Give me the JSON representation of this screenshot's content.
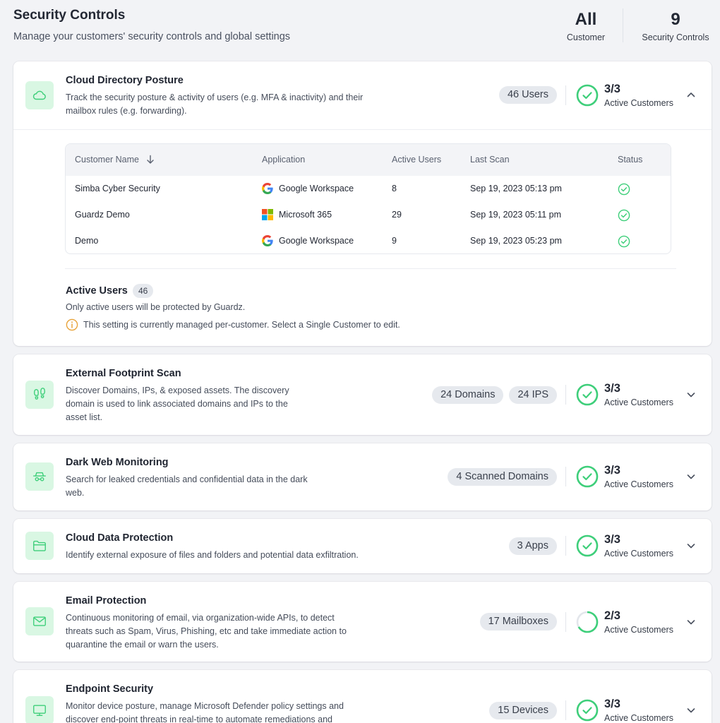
{
  "header": {
    "title": "Security Controls",
    "subtitle": "Manage your customers' security controls and global settings",
    "stats": {
      "customer_value": "All",
      "customer_label": "Customer",
      "controls_value": "9",
      "controls_label": "Security Controls"
    }
  },
  "colors": {
    "accent": "#3ecf7a",
    "icon_bg": "#d9f7e3",
    "pill_bg": "#e6e9ee"
  },
  "cards": [
    {
      "icon": "cloud-icon",
      "title": "Cloud Directory Posture",
      "desc_lines": [
        "Track the security posture & activity of users (e.g. MFA & inactivity) and their",
        "mailbox rules (e.g. forwarding)."
      ],
      "pills": [
        "46 Users"
      ],
      "ratio": "3/3",
      "ratio_label": "Active Customers",
      "progress": 1.0,
      "expanded": true
    },
    {
      "icon": "footprint-icon",
      "title": "External Footprint Scan",
      "desc_lines": [
        "Discover Domains, IPs, & exposed assets. The discovery",
        "domain is used to link associated domains and IPs to the",
        "asset list."
      ],
      "pills": [
        "24 Domains",
        "24 IPS"
      ],
      "ratio": "3/3",
      "ratio_label": "Active Customers",
      "progress": 1.0
    },
    {
      "icon": "spy-icon",
      "title": "Dark Web Monitoring",
      "desc_lines": [
        "Search for leaked credentials and confidential data in the dark",
        "web."
      ],
      "pills": [
        "4 Scanned Domains"
      ],
      "ratio": "3/3",
      "ratio_label": "Active Customers",
      "progress": 1.0
    },
    {
      "icon": "folder-icon",
      "title": "Cloud Data Protection",
      "desc_lines": [
        "Identify external exposure of files and folders and potential data exfiltration."
      ],
      "pills": [
        "3 Apps"
      ],
      "ratio": "3/3",
      "ratio_label": "Active Customers",
      "progress": 1.0
    },
    {
      "icon": "mail-icon",
      "title": "Email Protection",
      "desc_lines": [
        "Continuous monitoring of email, via organization-wide APIs, to detect",
        "threats such as Spam, Virus, Phishing, etc and take immediate action to",
        "quarantine the email or warn the users."
      ],
      "pills": [
        "17 Mailboxes"
      ],
      "ratio": "2/3",
      "ratio_label": "Active Customers",
      "progress": 0.667
    },
    {
      "icon": "monitor-icon",
      "title": "Endpoint Security",
      "desc_lines": [
        "Monitor device posture, manage Microsoft Defender policy settings and",
        "discover end-point threats in real-time to automate remediations and"
      ],
      "pills": [
        "15 Devices"
      ],
      "ratio": "3/3",
      "ratio_label": "Active Customers",
      "progress": 1.0
    }
  ],
  "directory_table": {
    "headers": [
      "Customer Name",
      "Application",
      "Active Users",
      "Last Scan",
      "Status"
    ],
    "rows": [
      {
        "customer": "Simba Cyber Security",
        "app": "Google Workspace",
        "app_icon": "google-icon",
        "users": "8",
        "last_scan": "Sep 19, 2023 05:13 pm",
        "status": "check-circle-icon"
      },
      {
        "customer": "Guardz Demo",
        "app": "Microsoft 365",
        "app_icon": "microsoft-icon",
        "users": "29",
        "last_scan": "Sep 19, 2023 05:11 pm",
        "status": "check-circle-icon"
      },
      {
        "customer": "Demo",
        "app": "Google Workspace",
        "app_icon": "google-icon",
        "users": "9",
        "last_scan": "Sep 19, 2023 05:23 pm",
        "status": "check-circle-icon"
      }
    ]
  },
  "active_users": {
    "title": "Active Users",
    "count": "46",
    "desc": "Only active users will be protected by Guardz.",
    "note": "This setting is currently managed per-customer. Select a Single Customer to edit."
  }
}
